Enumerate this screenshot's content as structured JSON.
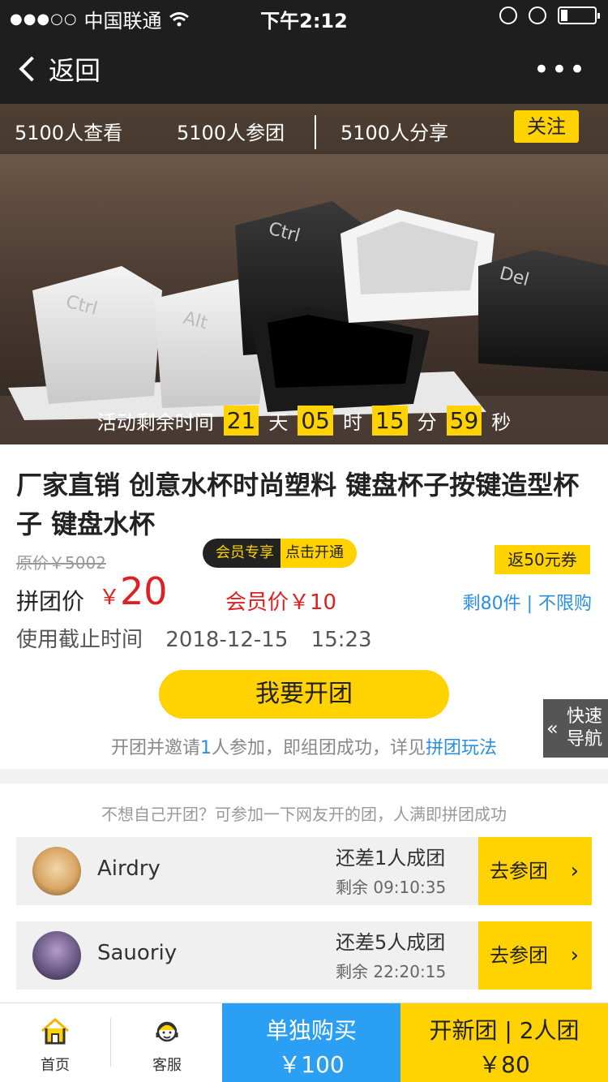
{
  "status": {
    "carrier": "中国联通",
    "time": "下午2:12",
    "battery_level": 0.2
  },
  "nav": {
    "back_label": "返回",
    "more_label": "•••"
  },
  "hero": {
    "stats": [
      "5100人查看",
      "5100人参团",
      "5100人分享"
    ],
    "follow_label": "关注",
    "countdown": {
      "label": "活动剩余时间",
      "days": "21",
      "days_unit": "天",
      "hours": "05",
      "hours_unit": "时",
      "minutes": "15",
      "minutes_unit": "分",
      "seconds": "59",
      "seconds_unit": "秒"
    }
  },
  "product": {
    "title": "厂家直销 创意水杯时尚塑料 键盘杯子按键造型杯子 键盘水杯",
    "original_price": "原价￥5002",
    "member_badge_left": "会员专享",
    "member_badge_right": "点击开通",
    "coupon": "返50元券",
    "group_price_label": "拼团价",
    "group_price_symbol": "￥",
    "group_price_value": "20",
    "member_price": "会员价￥10",
    "stock": "剩80件 | 不限购",
    "deadline_label": "使用截止时间",
    "deadline_date": "2018-12-15",
    "deadline_time": "15:23",
    "open_button": "我要开团",
    "invite_prefix": "开团并邀请",
    "invite_count": "1",
    "invite_suffix": "人参加，即组团成功，详见",
    "invite_link": "拼团玩法"
  },
  "quick_nav": {
    "chevron": "«",
    "label": "快速导航"
  },
  "join": {
    "hint": "不想自己开团？可参加一下网友开的团，人满即拼团成功",
    "groups": [
      {
        "user": "Airdry",
        "need": "还差1人成团",
        "remain": "剩余 09:10:35",
        "button": "去参团",
        "chevron": "›"
      },
      {
        "user": "Sauoriy",
        "need": "还差5人成团",
        "remain": "剩余 22:20:15",
        "button": "去参团",
        "chevron": "›"
      }
    ]
  },
  "bottom": {
    "home_label": "首页",
    "service_label": "客服",
    "single_label": "单独购买",
    "single_price": "￥100",
    "group_label": "开新团 | 2人团",
    "group_price": "￥80"
  },
  "colors": {
    "accent_yellow": "#ffd200",
    "price_red": "#e02020",
    "link_blue": "#2a8fe0",
    "single_buy_blue": "#2a9ff4",
    "dark_bar": "#1e1e1e"
  }
}
